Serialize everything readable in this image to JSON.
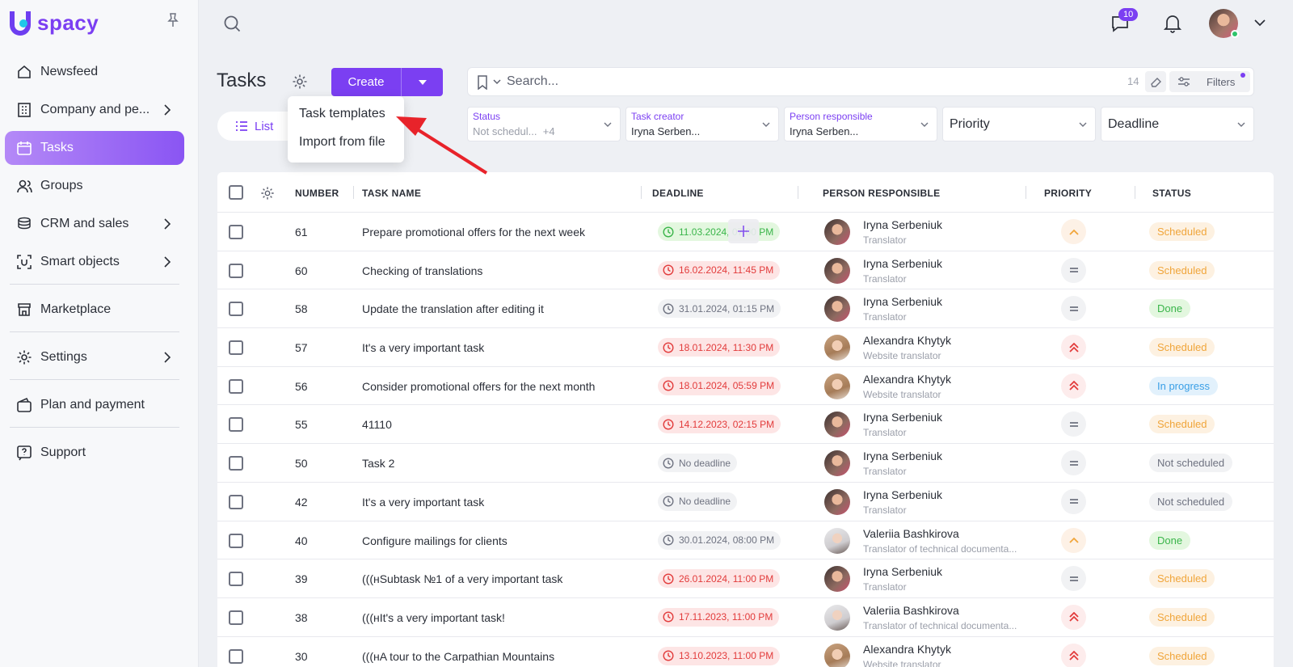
{
  "brand": {
    "logo_text": "spacy"
  },
  "sidebar": {
    "items": [
      {
        "label": "Newsfeed",
        "icon": "home-icon"
      },
      {
        "label": "Company and pe...",
        "icon": "building-icon"
      },
      {
        "label": "Tasks",
        "icon": "calendar-check-icon"
      },
      {
        "label": "Groups",
        "icon": "users-icon"
      },
      {
        "label": "CRM and sales",
        "icon": "coins-icon"
      },
      {
        "label": "Smart objects",
        "icon": "scan-icon"
      },
      {
        "label": "Marketplace",
        "icon": "store-icon"
      },
      {
        "label": "Settings",
        "icon": "gear-icon"
      },
      {
        "label": "Plan and payment",
        "icon": "wallet-icon"
      },
      {
        "label": "Support",
        "icon": "help-icon"
      }
    ],
    "active": "Tasks"
  },
  "topbar": {
    "messages_badge": "10"
  },
  "page": {
    "title": "Tasks",
    "create_label": "Create",
    "view_label": "List",
    "search_placeholder": "Search...",
    "search_count": "14",
    "filters_label": "Filters"
  },
  "dropdown": {
    "items": [
      "Task templates",
      "Import from file"
    ]
  },
  "filters": {
    "status": {
      "label": "Status",
      "value": "Not schedul...",
      "extra": "+4"
    },
    "creator": {
      "label": "Task creator",
      "value": "Iryna Serben..."
    },
    "responsible": {
      "label": "Person responsible",
      "value": "Iryna Serben..."
    },
    "priority": {
      "label": "Priority"
    },
    "deadline": {
      "label": "Deadline"
    }
  },
  "table": {
    "columns": [
      "NUMBER",
      "TASK NAME",
      "DEADLINE",
      "PERSON RESPONSIBLE",
      "PRIORITY",
      "STATUS"
    ],
    "rows": [
      {
        "num": "61",
        "name": "Prepare promotional offers for the next week",
        "deadline": "11.03.2024, 07:00 PM",
        "dl_state": "green",
        "person": "Iryna Serbeniuk",
        "role": "Translator",
        "avatar": "iryna",
        "priority": "up",
        "status": "Scheduled",
        "status_kind": "sched"
      },
      {
        "num": "60",
        "name": "Checking of translations",
        "deadline": "16.02.2024, 11:45 PM",
        "dl_state": "red",
        "person": "Iryna Serbeniuk",
        "role": "Translator",
        "avatar": "iryna",
        "priority": "eq",
        "status": "Scheduled",
        "status_kind": "sched"
      },
      {
        "num": "58",
        "name": "Update the translation after editing it",
        "deadline": "31.01.2024, 01:15 PM",
        "dl_state": "gray",
        "person": "Iryna Serbeniuk",
        "role": "Translator",
        "avatar": "iryna",
        "priority": "eq",
        "status": "Done",
        "status_kind": "done"
      },
      {
        "num": "57",
        "name": "It's a very important task",
        "deadline": "18.01.2024, 11:30 PM",
        "dl_state": "red",
        "person": "Alexandra Khytyk",
        "role": "Website translator",
        "avatar": "alex",
        "priority": "high",
        "status": "Scheduled",
        "status_kind": "sched"
      },
      {
        "num": "56",
        "name": "Consider promotional offers for the next month",
        "deadline": "18.01.2024, 05:59 PM",
        "dl_state": "red",
        "person": "Alexandra Khytyk",
        "role": "Website translator",
        "avatar": "alex",
        "priority": "high",
        "status": "In progress",
        "status_kind": "prog"
      },
      {
        "num": "55",
        "name": "41110",
        "deadline": "14.12.2023, 02:15 PM",
        "dl_state": "red",
        "person": "Iryna Serbeniuk",
        "role": "Translator",
        "avatar": "iryna",
        "priority": "eq",
        "status": "Scheduled",
        "status_kind": "sched"
      },
      {
        "num": "50",
        "name": "Task 2",
        "deadline": "No deadline",
        "dl_state": "gray",
        "person": "Iryna Serbeniuk",
        "role": "Translator",
        "avatar": "iryna",
        "priority": "eq",
        "status": "Not scheduled",
        "status_kind": "nots"
      },
      {
        "num": "42",
        "name": "It's a very important task",
        "deadline": "No deadline",
        "dl_state": "gray",
        "person": "Iryna Serbeniuk",
        "role": "Translator",
        "avatar": "iryna",
        "priority": "eq",
        "status": "Not scheduled",
        "status_kind": "nots"
      },
      {
        "num": "40",
        "name": "Configure mailings for clients",
        "deadline": "30.01.2024, 08:00 PM",
        "dl_state": "gray",
        "person": "Valeriia Bashkirova",
        "role": "Translator of technical documenta...",
        "avatar": "val",
        "priority": "up",
        "status": "Done",
        "status_kind": "done"
      },
      {
        "num": "39",
        "name": "(((нSubtask №1 of a very important task",
        "deadline": "26.01.2024, 11:00 PM",
        "dl_state": "red",
        "person": "Iryna Serbeniuk",
        "role": "Translator",
        "avatar": "iryna",
        "priority": "eq",
        "status": "Scheduled",
        "status_kind": "sched"
      },
      {
        "num": "38",
        "name": "(((нIt's a very important task!",
        "deadline": "17.11.2023, 11:00 PM",
        "dl_state": "red",
        "person": "Valeriia Bashkirova",
        "role": "Translator of technical documenta...",
        "avatar": "val",
        "priority": "high",
        "status": "Scheduled",
        "status_kind": "sched"
      },
      {
        "num": "30",
        "name": "(((нA tour to the Carpathian Mountains",
        "deadline": "13.10.2023, 11:00 PM",
        "dl_state": "red",
        "person": "Alexandra Khytyk",
        "role": "Website translator",
        "avatar": "alex",
        "priority": "high",
        "status": "Scheduled",
        "status_kind": "sched"
      }
    ]
  },
  "colors": {
    "accent": "#7b3ff2",
    "overdue": "#e23b3b",
    "scheduled": "#f0a53a",
    "done": "#3ab54a"
  }
}
